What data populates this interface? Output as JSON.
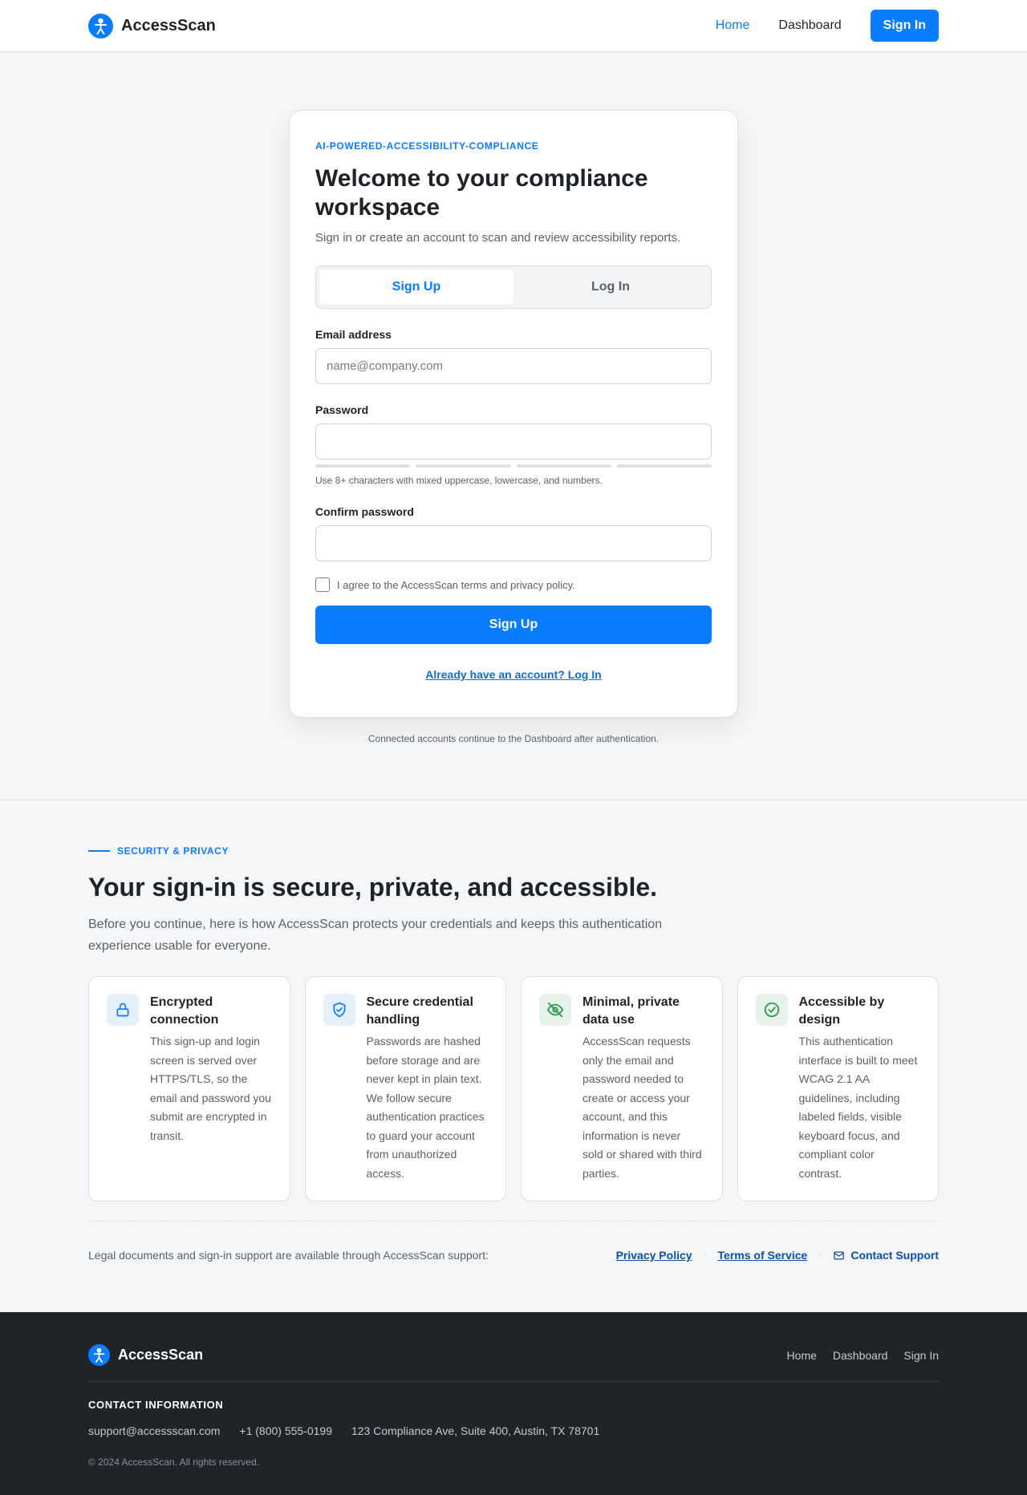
{
  "header": {
    "brand": "AccessScan",
    "nav": {
      "home": "Home",
      "dashboard": "Dashboard",
      "signin": "Sign In"
    }
  },
  "auth": {
    "eyebrow": "AI-POWERED-ACCESSIBILITY-COMPLIANCE",
    "title": "Welcome to your compliance workspace",
    "subtitle": "Sign in or create an account to scan and review accessibility reports.",
    "tabs": [
      "Sign Up",
      "Log In"
    ],
    "active_tab": "Sign Up",
    "email_label": "Email address",
    "email_placeholder": "name@company.com",
    "password_label": "Password",
    "password_value": "",
    "password_strength": 0,
    "password_hint": "Use 8+ characters with mixed uppercase, lowercase, and numbers.",
    "confirm_label": "Confirm password",
    "confirm_value": "",
    "agree_text": "I agree to the AccessScan terms and privacy policy.",
    "agree_checked": false,
    "submit_label": "Sign Up",
    "alt_link": "Already have an account? Log In",
    "note": "Connected accounts continue to the Dashboard after authentication."
  },
  "security": {
    "eyebrow": "SECURITY & PRIVACY",
    "title": "Your sign-in is secure, private, and accessible.",
    "lead": "Before you continue, here is how AccessScan protects your credentials and keeps this authentication experience usable for everyone.",
    "features": [
      {
        "icon": "lock-icon",
        "title": "Encrypted connection",
        "body": "This sign-up and login screen is served over HTTPS/TLS, so the email and password you submit are encrypted in transit."
      },
      {
        "icon": "shield-check-icon",
        "title": "Secure credential handling",
        "body": "Passwords are hashed before storage and are never kept in plain text. We follow secure authentication practices to guard your account from unauthorized access."
      },
      {
        "icon": "eye-off-icon",
        "title": "Minimal, private data use",
        "body": "AccessScan requests only the email and password needed to create or access your account, and this information is never sold or shared with third parties."
      },
      {
        "icon": "check-circle-icon",
        "title": "Accessible by design",
        "body": "This authentication interface is built to meet WCAG 2.1 AA guidelines, including labeled fields, visible keyboard focus, and compliant color contrast."
      }
    ],
    "legal_text": "Legal documents and sign-in support are available through AccessScan support:",
    "privacy": "Privacy Policy",
    "terms": "Terms of Service",
    "contact": "Contact Support"
  },
  "footer": {
    "brand": "AccessScan",
    "nav": [
      "Home",
      "Dashboard",
      "Sign In"
    ],
    "contact_heading": "CONTACT INFORMATION",
    "email": "support@accessscan.com",
    "phone": "+1 (800) 555-0199",
    "address": "123 Compliance Ave, Suite 400, Austin, TX 78701",
    "copyright": "© 2024 AccessScan. All rights reserved."
  },
  "colors": {
    "accent": "#0a7cff",
    "footer_bg": "#202328",
    "success": "#2e9b4e"
  }
}
